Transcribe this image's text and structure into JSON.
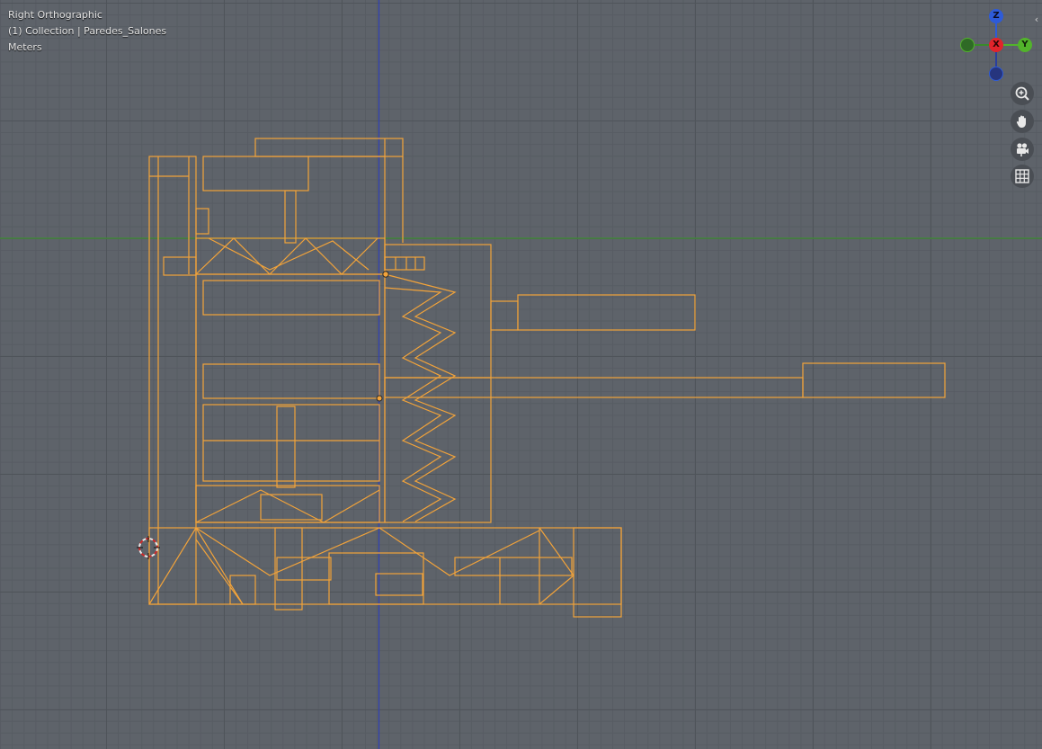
{
  "viewport": {
    "view_name": "Right Orthographic",
    "collection_info": "(1) Collection | Paredes_Salones",
    "units": "Meters"
  },
  "gizmo": {
    "z_label": "Z",
    "x_label": "X",
    "y_label": "Y",
    "colors": {
      "z": "#2e5bd8",
      "x": "#e2242b",
      "y": "#52b32b",
      "neg_y": "#3a8a2a",
      "neg_z": "#2a3f9e"
    }
  },
  "nav_buttons": [
    {
      "icon": "zoom-icon"
    },
    {
      "icon": "hand-pan-icon"
    },
    {
      "icon": "camera-icon"
    },
    {
      "icon": "grid-icon"
    }
  ],
  "colors": {
    "selection": "#f2a33a",
    "x_axis_line": "#3f8f33",
    "z_axis_line": "#2f3fb4",
    "background": "#5e636a"
  }
}
